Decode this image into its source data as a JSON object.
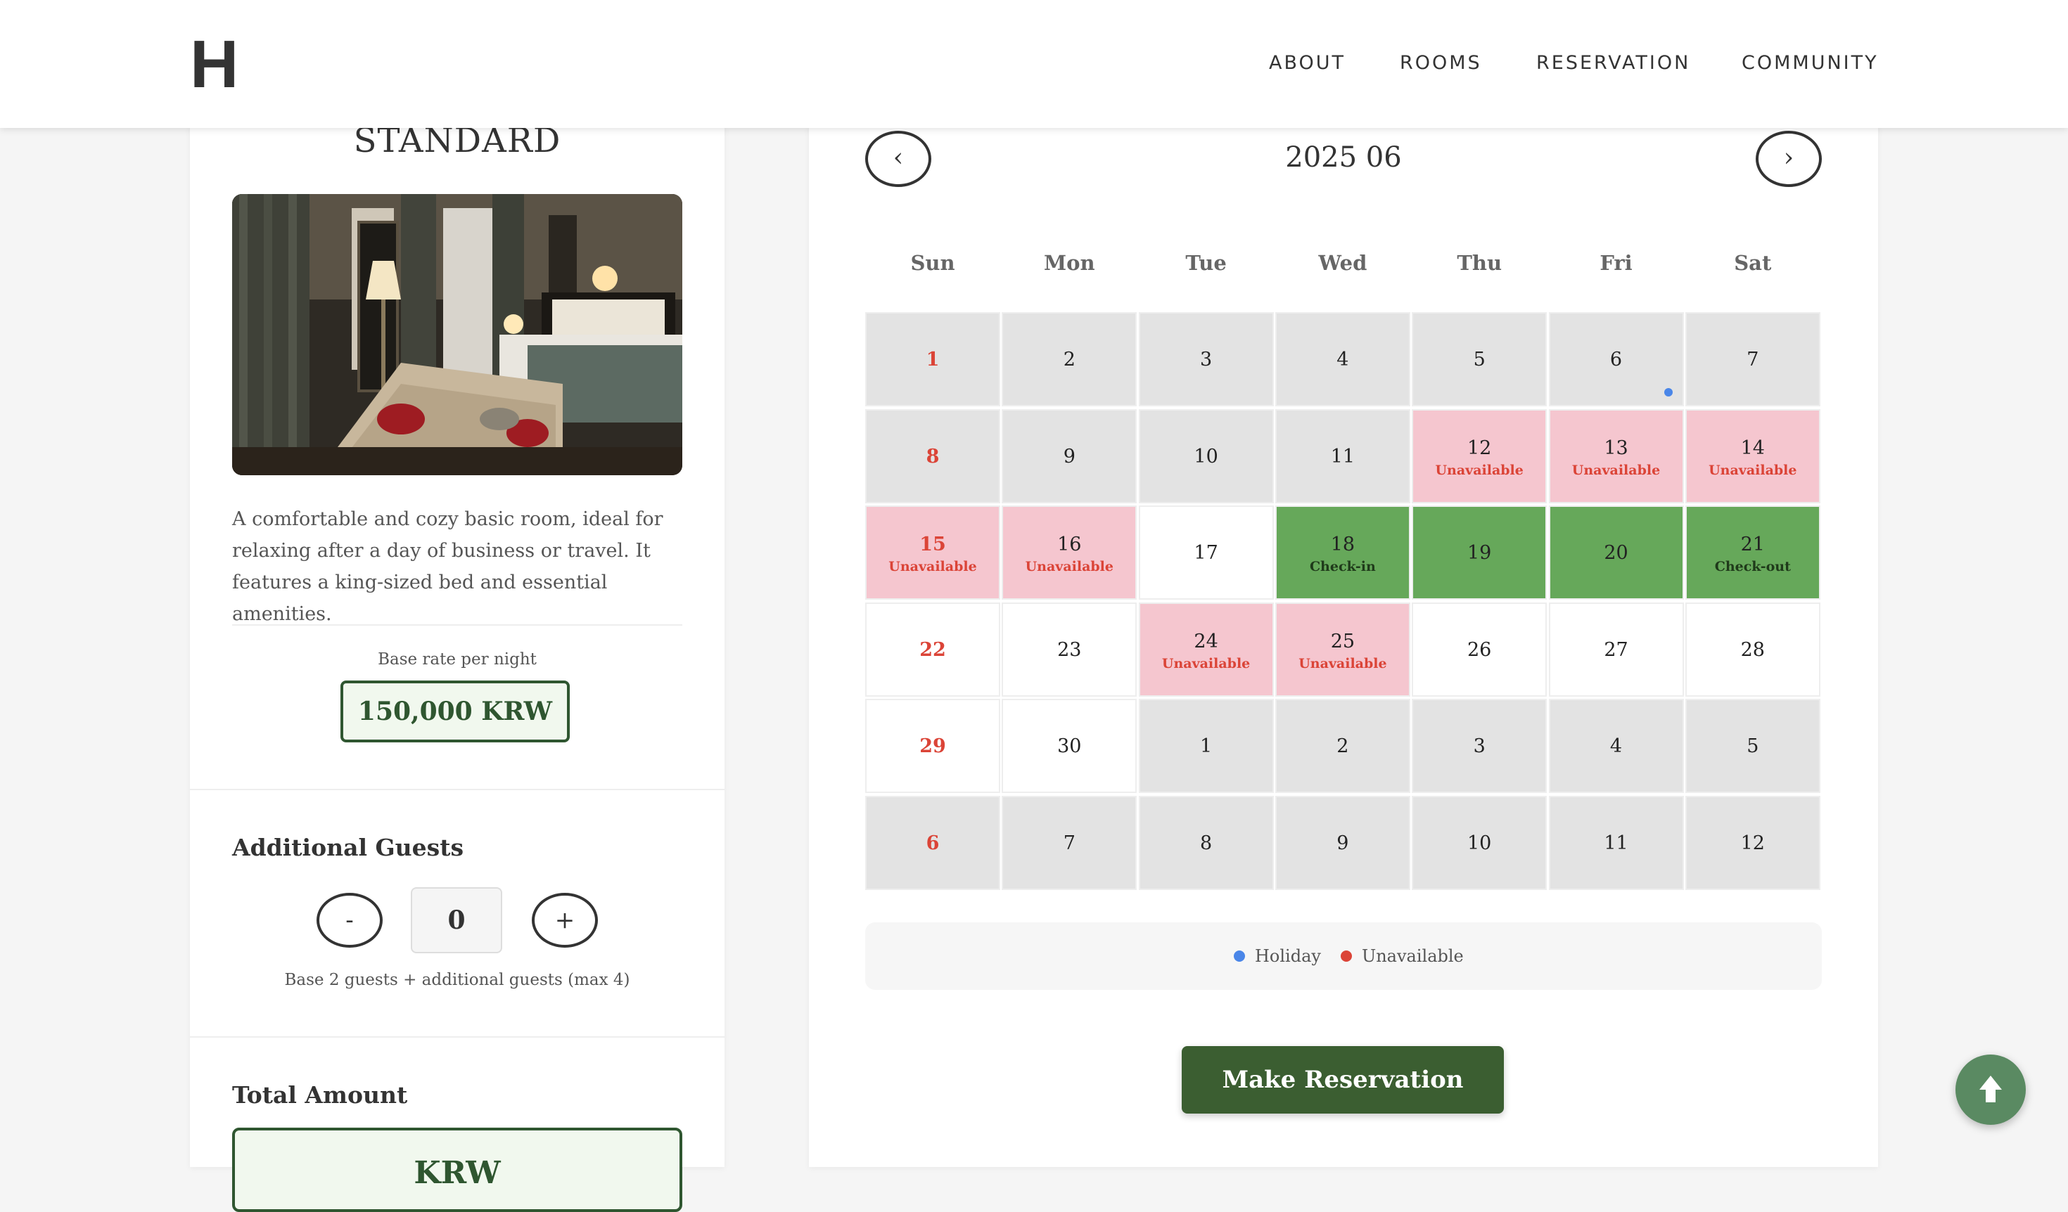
{
  "header": {
    "logo": "H",
    "nav": [
      "ABOUT",
      "ROOMS",
      "RESERVATION",
      "COMMUNITY"
    ]
  },
  "room": {
    "title": "STANDARD",
    "description": "A comfortable and cozy basic room, ideal for relaxing after a day of business or travel. It features a king-sized bed and essential amenities.",
    "rate_label": "Base rate per night",
    "rate": "150,000 KRW"
  },
  "guests": {
    "title": "Additional Guests",
    "minus_label": "-",
    "plus_label": "+",
    "count": "0",
    "note": "Base 2 guests + additional guests (max 4)"
  },
  "total": {
    "title": "Total Amount",
    "value": "KRW"
  },
  "calendar": {
    "prev_label": "‹",
    "next_label": "›",
    "month": "2025 06",
    "weekdays": [
      "Sun",
      "Mon",
      "Tue",
      "Wed",
      "Thu",
      "Fri",
      "Sat"
    ],
    "weeks": [
      [
        {
          "d": "1",
          "s": "other"
        },
        {
          "d": "2",
          "s": "other"
        },
        {
          "d": "3",
          "s": "other"
        },
        {
          "d": "4",
          "s": "other"
        },
        {
          "d": "5",
          "s": "other"
        },
        {
          "d": "6",
          "s": "other",
          "holiday": true
        },
        {
          "d": "7",
          "s": "other"
        }
      ],
      [
        {
          "d": "8",
          "s": "other"
        },
        {
          "d": "9",
          "s": "other"
        },
        {
          "d": "10",
          "s": "other"
        },
        {
          "d": "11",
          "s": "other"
        },
        {
          "d": "12",
          "s": "unavail",
          "label": "Unavailable"
        },
        {
          "d": "13",
          "s": "unavail",
          "label": "Unavailable"
        },
        {
          "d": "14",
          "s": "unavail",
          "label": "Unavailable"
        }
      ],
      [
        {
          "d": "15",
          "s": "unavail",
          "label": "Unavailable"
        },
        {
          "d": "16",
          "s": "unavail",
          "label": "Unavailable"
        },
        {
          "d": "17",
          "s": "normal"
        },
        {
          "d": "18",
          "s": "selected",
          "label": "Check-in"
        },
        {
          "d": "19",
          "s": "selected"
        },
        {
          "d": "20",
          "s": "selected"
        },
        {
          "d": "21",
          "s": "selected",
          "label": "Check-out"
        }
      ],
      [
        {
          "d": "22",
          "s": "normal"
        },
        {
          "d": "23",
          "s": "normal"
        },
        {
          "d": "24",
          "s": "unavail",
          "label": "Unavailable"
        },
        {
          "d": "25",
          "s": "unavail",
          "label": "Unavailable"
        },
        {
          "d": "26",
          "s": "normal"
        },
        {
          "d": "27",
          "s": "normal"
        },
        {
          "d": "28",
          "s": "normal"
        }
      ],
      [
        {
          "d": "29",
          "s": "normal"
        },
        {
          "d": "30",
          "s": "normal"
        },
        {
          "d": "1",
          "s": "other"
        },
        {
          "d": "2",
          "s": "other"
        },
        {
          "d": "3",
          "s": "other"
        },
        {
          "d": "4",
          "s": "other"
        },
        {
          "d": "5",
          "s": "other"
        }
      ],
      [
        {
          "d": "6",
          "s": "other"
        },
        {
          "d": "7",
          "s": "other"
        },
        {
          "d": "8",
          "s": "other"
        },
        {
          "d": "9",
          "s": "other"
        },
        {
          "d": "10",
          "s": "other"
        },
        {
          "d": "11",
          "s": "other"
        },
        {
          "d": "12",
          "s": "other"
        }
      ]
    ],
    "legend": [
      {
        "label": "Holiday",
        "color": "#4a86e8"
      },
      {
        "label": "Unavailable",
        "color": "#db4437"
      }
    ],
    "reserve_label": "Make Reservation"
  },
  "colors": {
    "other_bg": "#e3e3e3",
    "unavail_bg": "#f5c6cf",
    "selected_bg": "#66a85a",
    "normal_bg": "#ffffff",
    "sunday": "#db4437",
    "unavail_text": "#db4437",
    "accent": "#3b5e31"
  },
  "icons": {
    "scroll_top": "arrow-up-icon",
    "prev": "chevron-left-icon",
    "next": "chevron-right-icon"
  }
}
